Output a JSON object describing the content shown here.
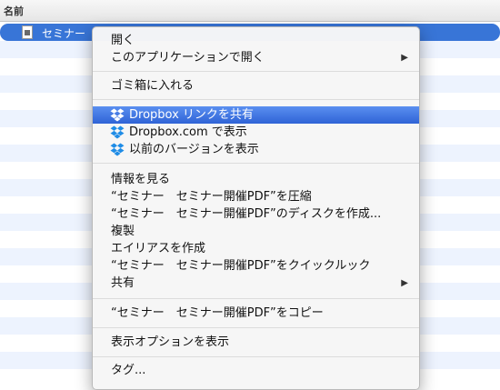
{
  "finder": {
    "column_header": "名前",
    "selected_file": "セミナー",
    "file_icon": "document-icon"
  },
  "menu": {
    "open": "開く",
    "open_with": "このアプリケーションで開く",
    "trash": "ゴミ箱に入れる",
    "dropbox_link": "Dropbox リンクを共有",
    "dropbox_view": "Dropbox.com で表示",
    "dropbox_versions": "以前のバージョンを表示",
    "get_info": "情報を見る",
    "compress": "“セミナー　セミナー開催PDF”を圧縮",
    "burn": "“セミナー　セミナー開催PDF”のディスクを作成...",
    "duplicate": "複製",
    "alias": "エイリアスを作成",
    "quicklook": "“セミナー　セミナー開催PDF”をクイックルック",
    "share": "共有",
    "copy": "“セミナー　セミナー開催PDF”をコピー",
    "view_options": "表示オプションを表示",
    "tags": "タグ...",
    "submenu_arrow": "▶",
    "dropbox_icon": "dropbox-icon",
    "colors": {
      "highlight": "#3875d7",
      "dropbox": "#1f8ce6"
    }
  }
}
